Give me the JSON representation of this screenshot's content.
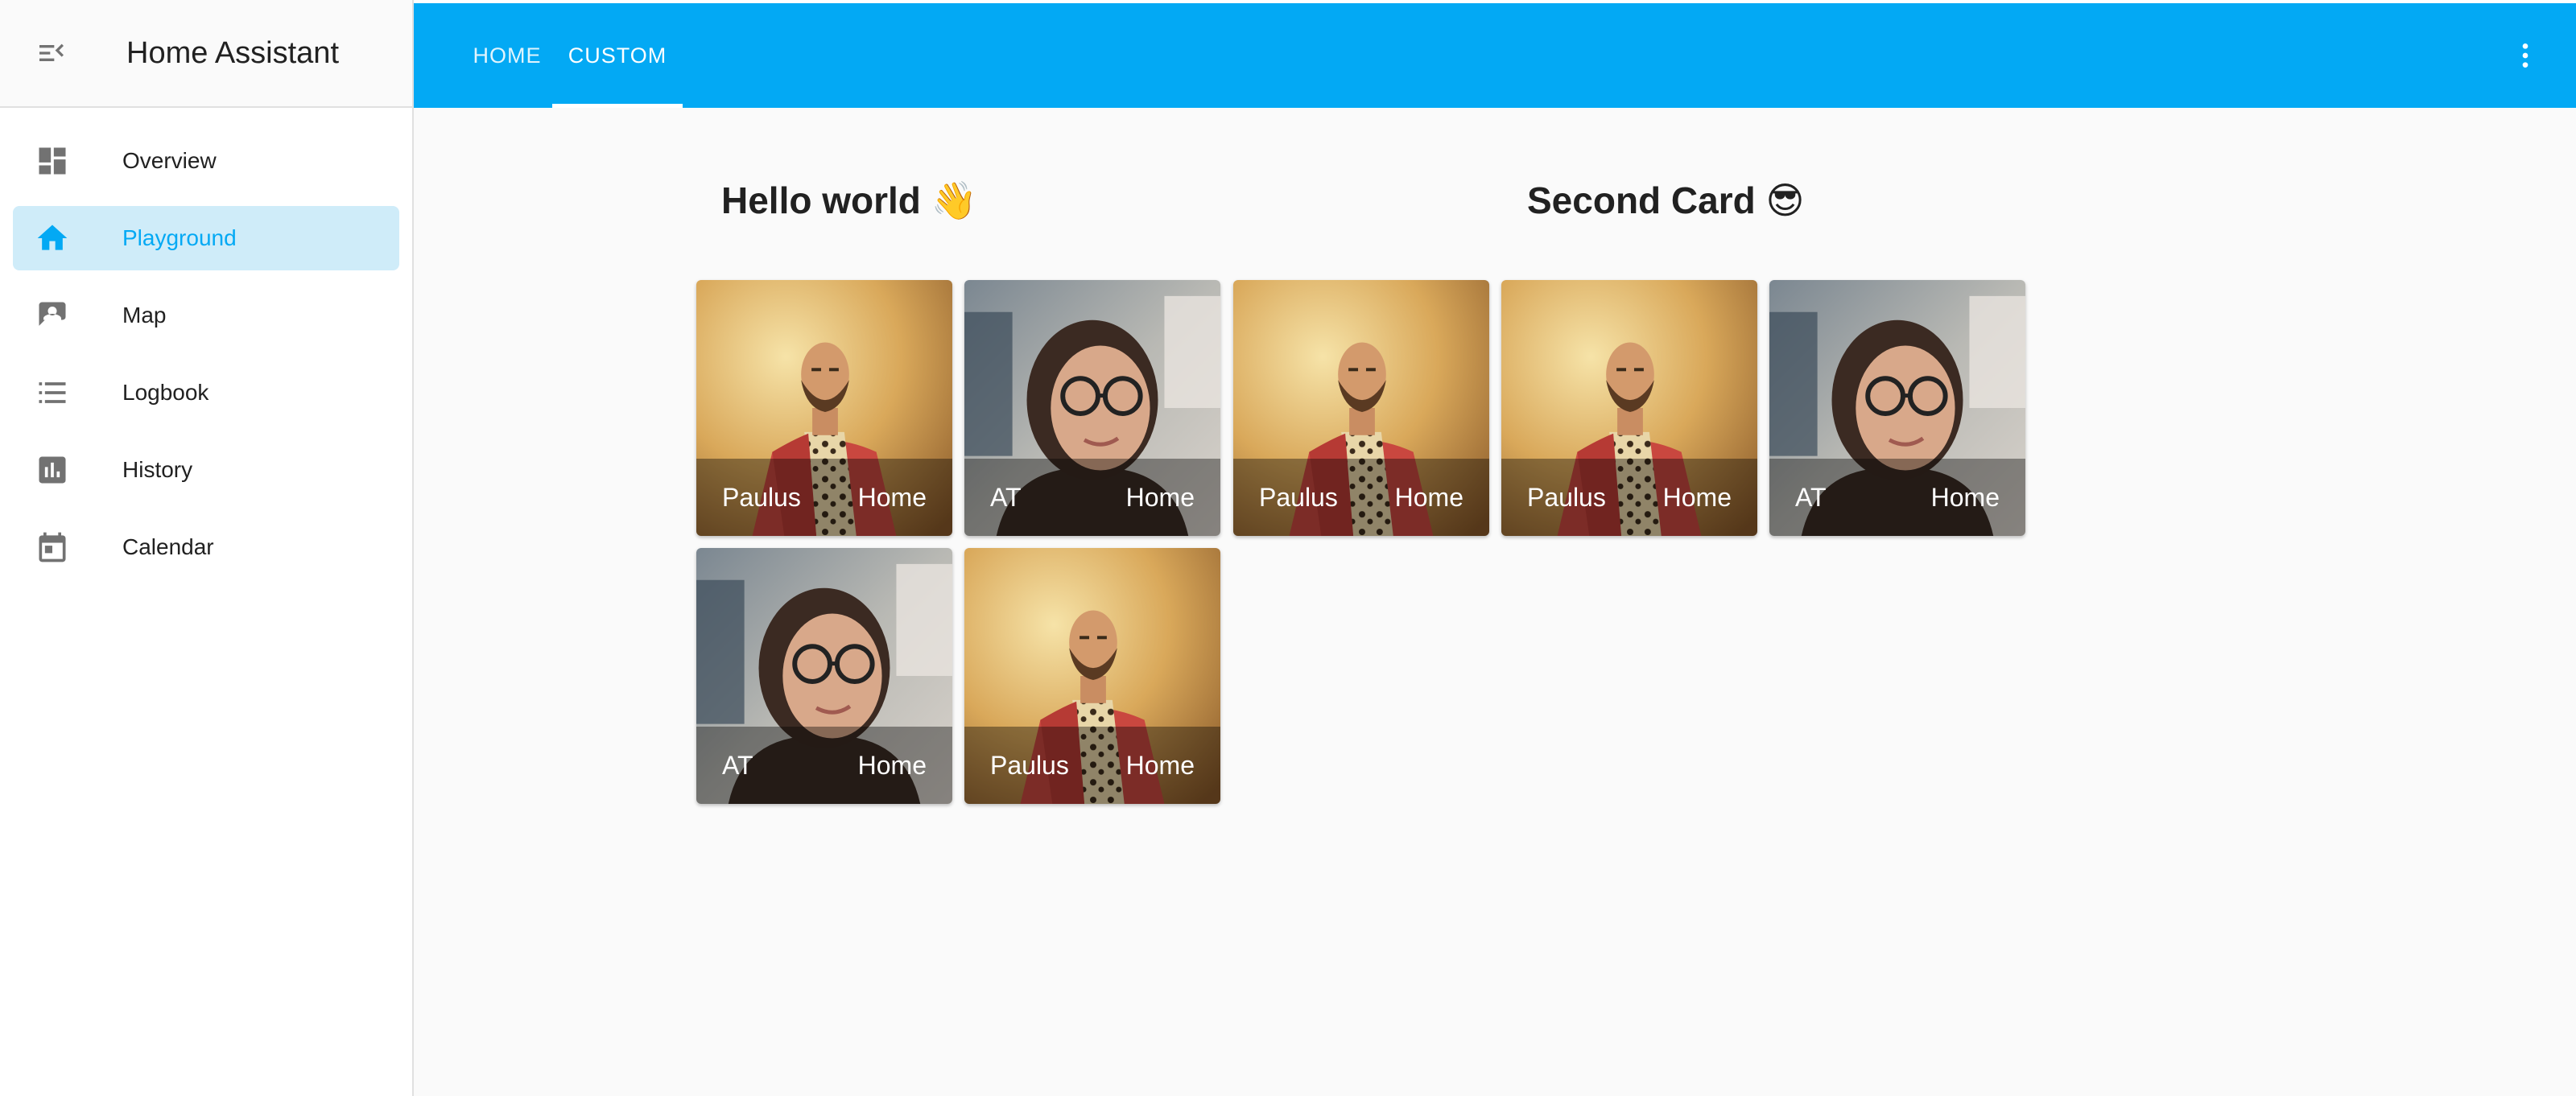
{
  "app": {
    "title": "Home Assistant"
  },
  "sidebar": {
    "items": [
      {
        "label": "Overview",
        "icon": "dashboard-icon"
      },
      {
        "label": "Playground",
        "icon": "home-icon",
        "active": true
      },
      {
        "label": "Map",
        "icon": "account-box-icon"
      },
      {
        "label": "Logbook",
        "icon": "list-icon"
      },
      {
        "label": "History",
        "icon": "chart-box-icon"
      },
      {
        "label": "Calendar",
        "icon": "calendar-icon"
      }
    ]
  },
  "topbar": {
    "tabs": [
      {
        "label": "HOME"
      },
      {
        "label": "CUSTOM",
        "active": true
      }
    ]
  },
  "cards": [
    {
      "title": "Hello world 👋"
    },
    {
      "title": "Second Card 😎"
    }
  ],
  "tiles": [
    {
      "name": "Paulus",
      "state": "Home",
      "photo": "man-red-robe"
    },
    {
      "name": "AT",
      "state": "Home",
      "photo": "woman-glasses"
    },
    {
      "name": "Paulus",
      "state": "Home",
      "photo": "man-red-robe"
    },
    {
      "name": "Paulus",
      "state": "Home",
      "photo": "man-red-robe"
    },
    {
      "name": "AT",
      "state": "Home",
      "photo": "woman-glasses"
    },
    {
      "name": "AT",
      "state": "Home",
      "photo": "woman-glasses"
    },
    {
      "name": "Paulus",
      "state": "Home",
      "photo": "man-red-robe"
    }
  ],
  "colors": {
    "primary": "#03a9f4",
    "active_bg": "#cfecf9",
    "icon": "#727272"
  }
}
